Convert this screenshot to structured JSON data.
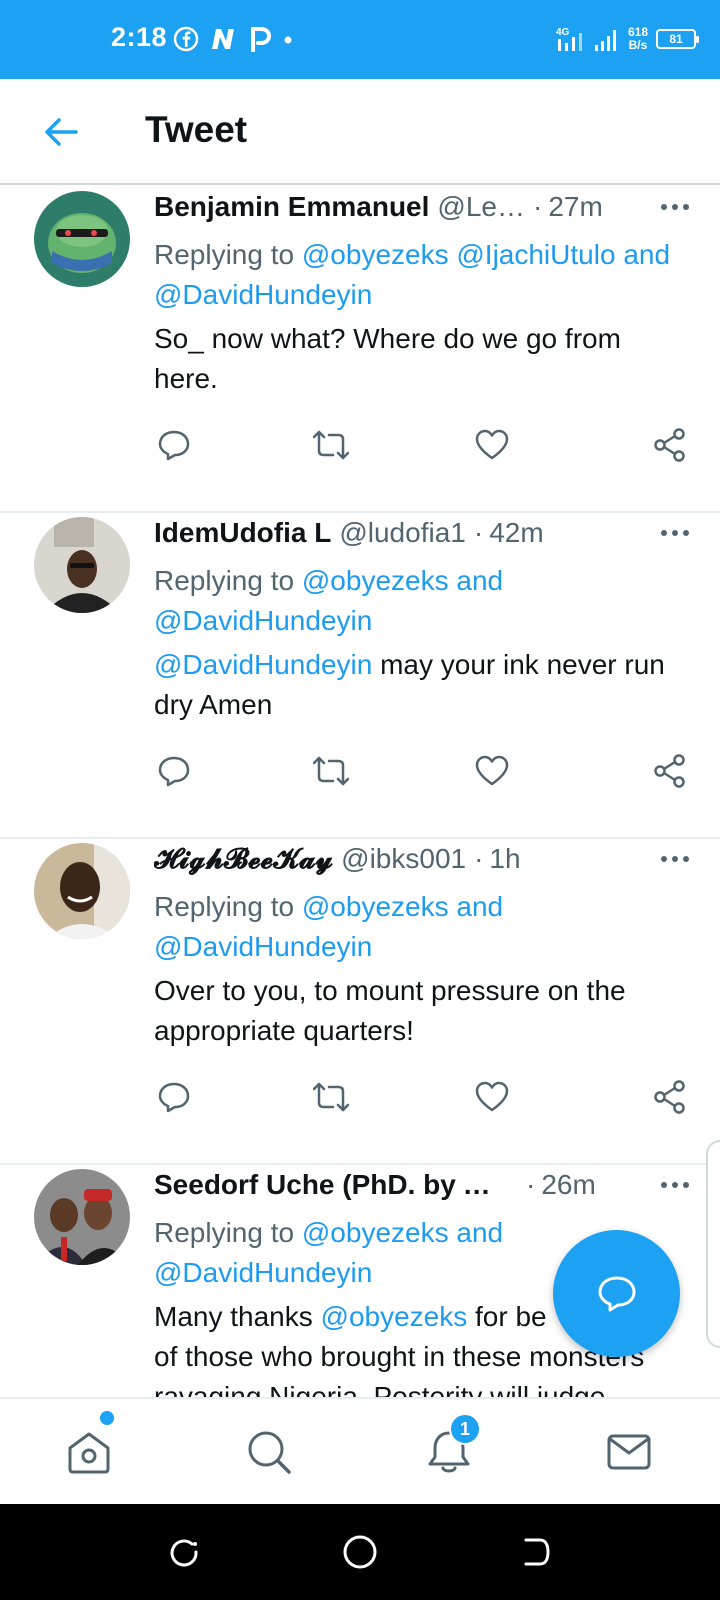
{
  "status_bar": {
    "time": "2:18",
    "network_type": "4G",
    "net_speed_value": "618",
    "net_speed_unit": "B/s",
    "battery": "81",
    "bg_color": "#1da1f2"
  },
  "header": {
    "title": "Tweet"
  },
  "tweets": [
    {
      "name": "Benjamin Emmanuel",
      "handle": "@Le…",
      "dot": "·",
      "time": "27m",
      "replying_prefix": "Replying to",
      "replying_mentions": "@obyezeks @IjachiUtulo",
      "replying_and": "and",
      "replying_last": "@DavidHundeyin",
      "text": "So_ now what?  Where do we go from here."
    },
    {
      "name": "IdemUdofia L",
      "handle": "@ludofia1",
      "dot": "·",
      "time": "42m",
      "replying_prefix": "Replying to",
      "replying_mentions": "@obyezeks and",
      "replying_last": "@DavidHundeyin",
      "text_mention": "@DavidHundeyin",
      "text": " may your ink never run dry Amen"
    },
    {
      "name": "𝓗𝓲𝓰𝓱𝓑𝓮𝓮𝓚𝓪𝔂",
      "handle": "@ibks001",
      "dot": "·",
      "time": "1h",
      "replying_prefix": "Replying to",
      "replying_mentions": "@obyezeks and",
      "replying_last": "@DavidHundeyin",
      "text": "Over to you, to mount pressure on the appropriate quarters!"
    },
    {
      "name": "Seedorf Uche (PhD. by A…",
      "dot": "·",
      "time": "26m",
      "replying_prefix": "Replying to",
      "replying_mentions": "@obyezeks and",
      "replying_last": "@DavidHundeyin",
      "text_before": "Many thanks ",
      "text_mention": "@obyezeks",
      "text_after": " for be",
      "text_line2": "of those who brought in these monsters",
      "text_line3": "ravaging Nigeria. Posterity will judge"
    }
  ],
  "bottom_nav": {
    "items": [
      "home-icon",
      "search-icon",
      "notifications-icon",
      "messages-icon"
    ],
    "notification_count": "1"
  },
  "colors": {
    "accent": "#1da1f2",
    "mention": "#1d9bf0",
    "secondary_text": "#536471"
  }
}
